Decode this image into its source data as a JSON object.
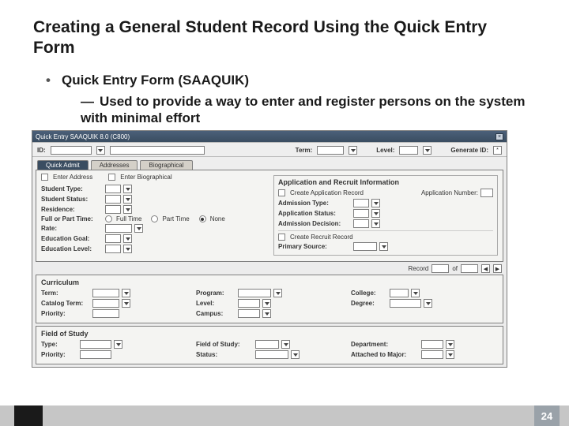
{
  "slide": {
    "title": "Creating a General Student Record Using the Quick Entry Form",
    "bullet1": "Quick Entry Form (SAAQUIK)",
    "bullet2": "Used to provide a way to enter and register persons on the system with minimal effort",
    "page_number": "24"
  },
  "titlebar": {
    "text": "Quick Entry SAAQUIK 8.0 (C800)"
  },
  "keyblock": {
    "id_label": "ID:",
    "term_label": "Term:",
    "level_label": "Level:",
    "generate_id_label": "Generate ID:",
    "generate_icon": "*"
  },
  "tabs": {
    "quick_admit": "Quick Admit",
    "addresses": "Addresses",
    "biographical": "Biographical"
  },
  "enter": {
    "address": "Enter Address",
    "bio": "Enter Biographical"
  },
  "student": {
    "type": "Student Type:",
    "status": "Student Status:",
    "residence": "Residence:",
    "fpt": "Full or Part Time:",
    "ft": "Full Time",
    "pt": "Part Time",
    "none": "None",
    "rate": "Rate:",
    "edu_goal": "Education Goal:",
    "edu_level": "Education Level:"
  },
  "apprec": {
    "title": "Application and Recruit Information",
    "create_app": "Create Application Record",
    "app_num": "Application Number:",
    "adm_type": "Admission Type:",
    "app_status": "Application Status:",
    "adm_dec": "Admission Decision:",
    "create_rec": "Create Recruit Record",
    "prim_src": "Primary Source:"
  },
  "curriculum": {
    "title": "Curriculum",
    "record": "Record",
    "of": "of",
    "term": "Term:",
    "catalog": "Catalog Term:",
    "priority": "Priority:",
    "program": "Program:",
    "level": "Level:",
    "campus": "Campus:",
    "college": "College:",
    "degree": "Degree:"
  },
  "fos": {
    "title": "Field of Study",
    "type": "Type:",
    "priority": "Priority:",
    "field": "Field of Study:",
    "status": "Status:",
    "dept": "Department:",
    "attached": "Attached to Major:"
  }
}
